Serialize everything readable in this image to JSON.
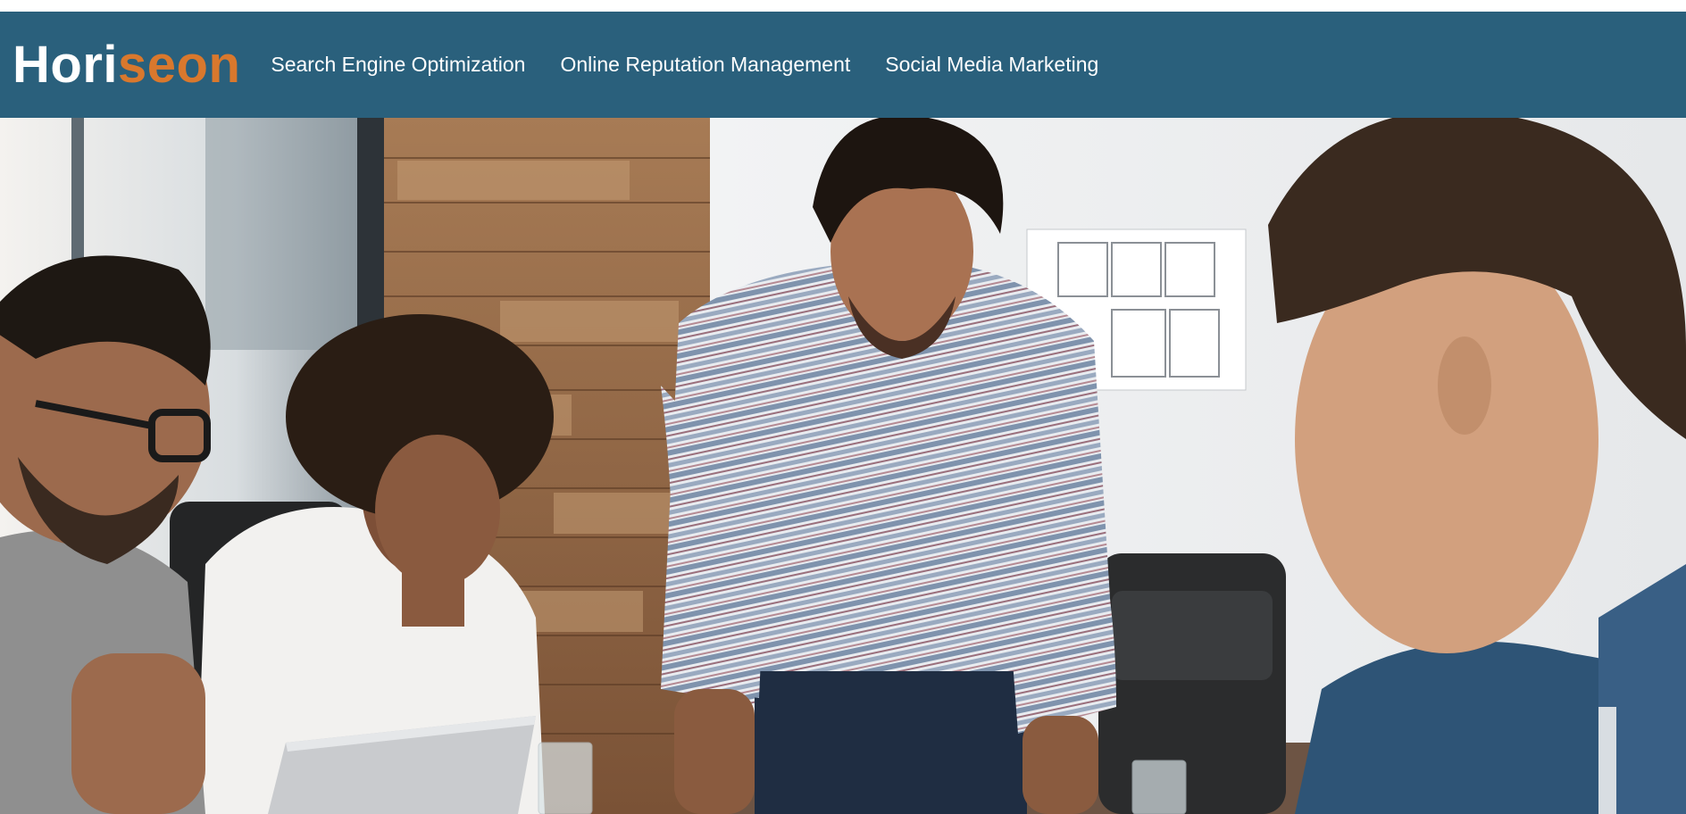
{
  "header": {
    "logo_part1": "Hori",
    "logo_part2": "seon",
    "nav": [
      {
        "label": "Search Engine Optimization"
      },
      {
        "label": "Online Reputation Management"
      },
      {
        "label": "Social Media Marketing"
      }
    ]
  },
  "hero": {
    "image_description_icon": "team-meeting-photo"
  },
  "colors": {
    "header_bg": "#2a607c",
    "logo_accent": "#d9782d",
    "nav_text": "#ffffff"
  }
}
